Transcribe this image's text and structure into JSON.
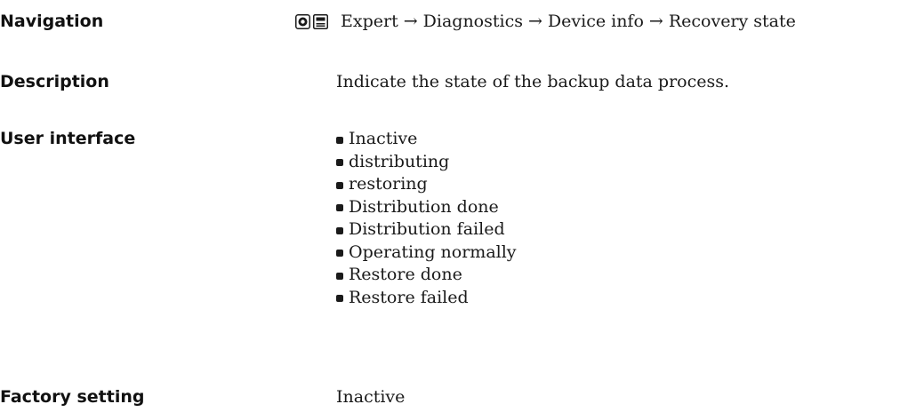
{
  "navigation": {
    "label": "Navigation",
    "icons": [
      "operating-menu-icon",
      "display-menu-icon"
    ],
    "path": [
      "Expert",
      "Diagnostics",
      "Device info",
      "Recovery state"
    ],
    "separator": "→"
  },
  "description": {
    "label": "Description",
    "text": "Indicate the state of the backup data process."
  },
  "user_interface": {
    "label": "User interface",
    "options": [
      "Inactive",
      "distributing",
      "restoring",
      "Distribution done",
      "Distribution failed",
      "Operating normally",
      "Restore done",
      "Restore failed"
    ]
  },
  "factory_setting": {
    "label": "Factory setting",
    "value": "Inactive"
  }
}
